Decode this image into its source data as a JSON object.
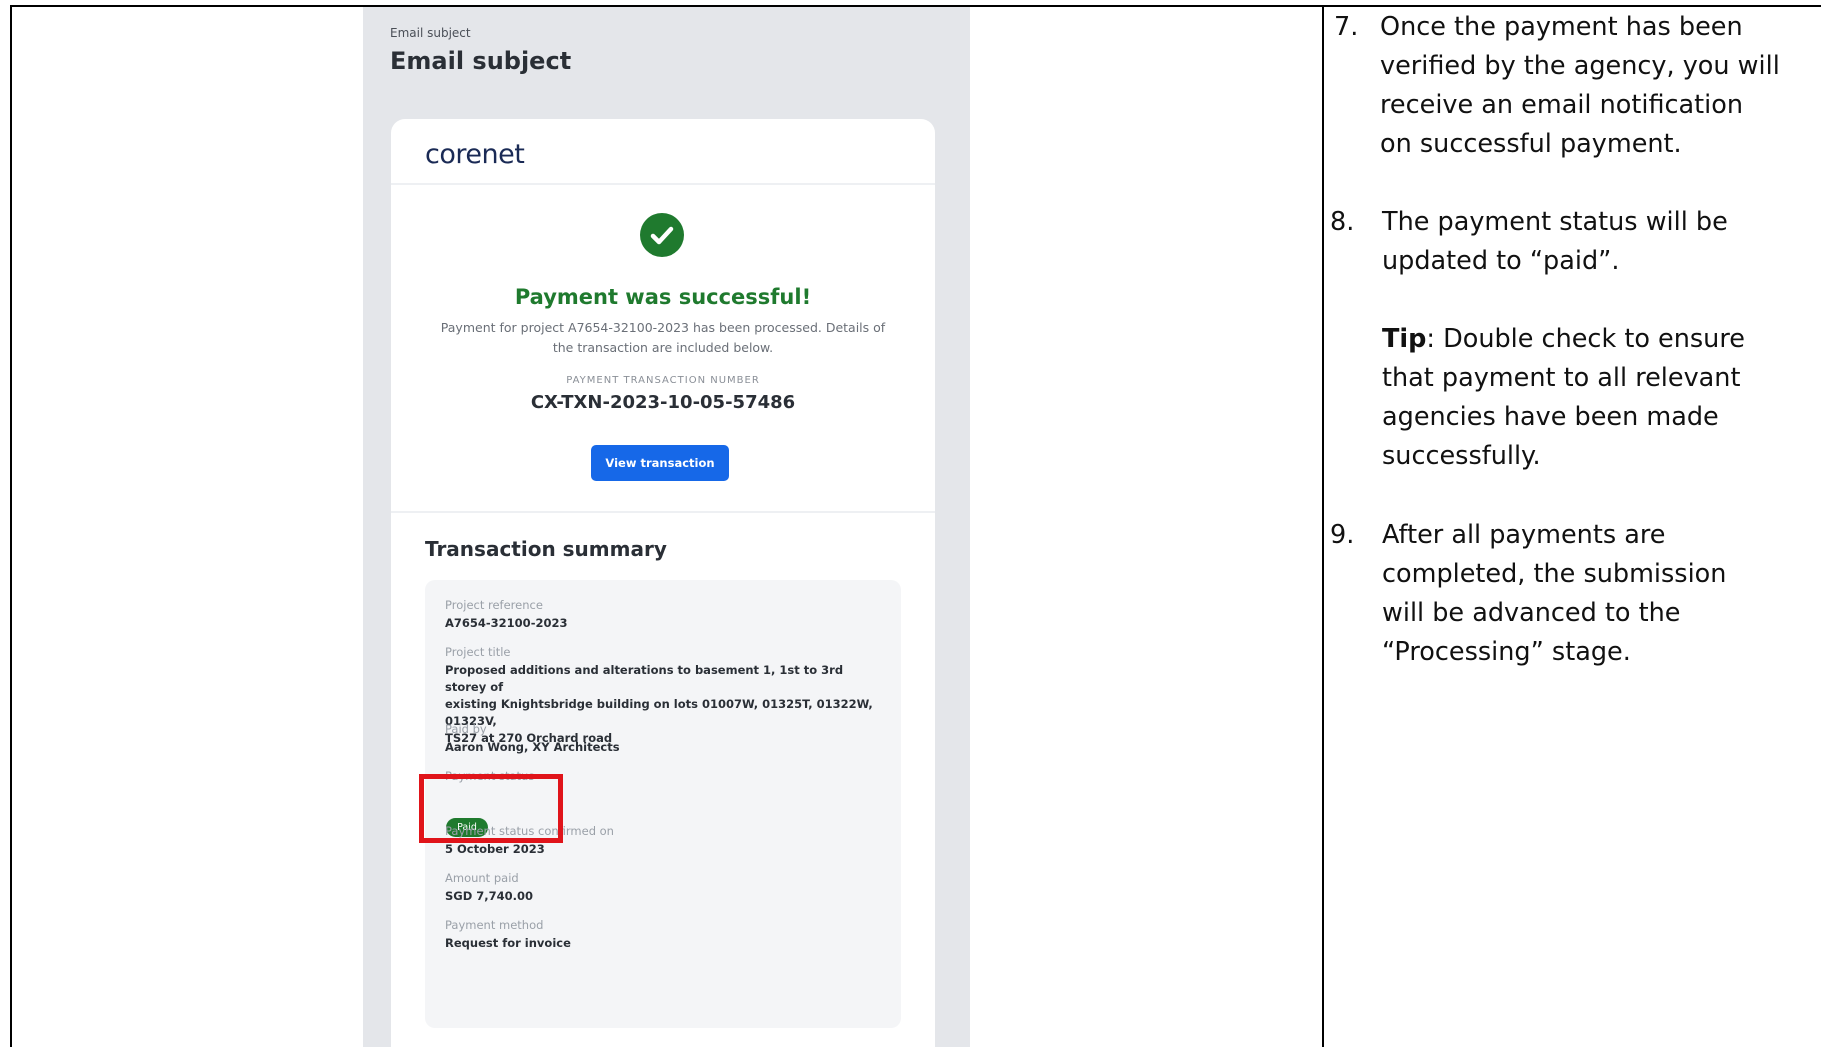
{
  "email": {
    "meta_label": "Email subject",
    "subject_title": "Email subject",
    "brand": "corenet",
    "success_title": "Payment was successful!",
    "success_desc_line1": "Payment for project A7654-32100-2023 has been processed. Details of",
    "success_desc_line2": "the transaction are included below.",
    "txn_label": "PAYMENT TRANSACTION NUMBER",
    "txn_number": "CX-TXN-2023-10-05-57486",
    "view_button": "View transaction",
    "summary_title": "Transaction summary",
    "fields": {
      "project_ref_label": "Project reference",
      "project_ref_value": "A7654-32100-2023",
      "project_title_label": "Project title",
      "project_title_line1": "Proposed additions and alterations to basement 1, 1st to 3rd storey of",
      "project_title_line2": "existing Knightsbridge building on lots 01007W, 01325T, 01322W, 01323V,",
      "project_title_line3": "TS27 at 270 Orchard road",
      "paid_by_label": "Paid by",
      "paid_by_value": "Aaron Wong, XY Architects",
      "status_label": "Payment status",
      "status_badge": "Paid",
      "confirmed_label": "Payment status confirmed on",
      "confirmed_value": "5 October 2023",
      "amount_label": "Amount paid",
      "amount_value": "SGD 7,740.00",
      "method_label": "Payment method",
      "method_value": "Request for invoice"
    },
    "colors": {
      "success_green": "#1f7a2e",
      "button_blue": "#1668e8",
      "highlight_red": "#e0141a"
    }
  },
  "steps": {
    "step7_num": "7.",
    "step7_line1": "Once the payment has been",
    "step7_line2": "verified by the agency, you will",
    "step7_line3": "receive an email notification",
    "step7_line4": "on successful payment.",
    "step8_num": "8.",
    "step8_line1": "The payment status will be",
    "step8_line2": "updated to “paid”.",
    "tip_label": "Tip",
    "tip_line1_rest": ": Double check to ensure",
    "tip_line2": "that payment to all relevant",
    "tip_line3": "agencies have been made",
    "tip_line4": "successfully.",
    "step9_num": "9.",
    "step9_line1": "After all payments are",
    "step9_line2": "completed, the submission",
    "step9_line3": "will be advanced to the",
    "step9_line4": "“Processing” stage."
  }
}
